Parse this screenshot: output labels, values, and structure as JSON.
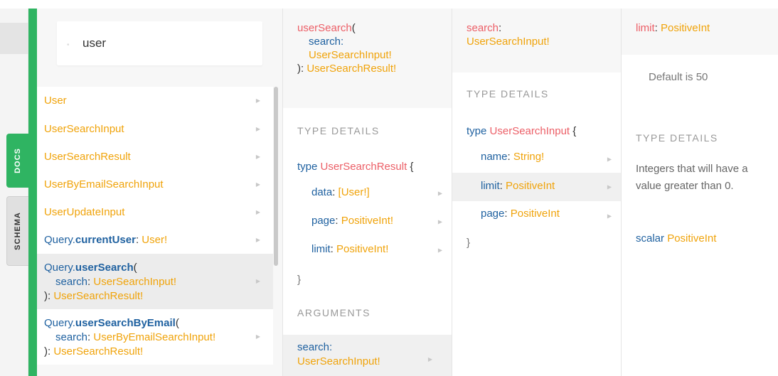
{
  "tabs": {
    "docs": "DOCS",
    "schema": "SCHEMA"
  },
  "search": {
    "value": "user"
  },
  "results": [
    {
      "name": "User"
    },
    {
      "name": "UserSearchInput"
    },
    {
      "name": "UserSearchResult"
    },
    {
      "name": "UserByEmailSearchInput"
    },
    {
      "name": "UserUpdateInput"
    },
    {
      "prefix": "Query.",
      "field": "currentUser",
      "colon": ": ",
      "type": "User!"
    },
    {
      "prefix": "Query.",
      "field": "userSearch",
      "open": "(",
      "arg": "search",
      "argColon": ": ",
      "argType": "UserSearchInput!",
      "close": "): ",
      "type": "UserSearchResult!"
    },
    {
      "prefix": "Query.",
      "field": "userSearchByEmail",
      "open": "(",
      "arg": "search",
      "argColon": ": ",
      "argType": "UserByEmailSearchInput!",
      "close": "): ",
      "type": "UserSearchResult!"
    }
  ],
  "col2": {
    "header": {
      "name": "userSearch",
      "open": "(",
      "arg": "search:",
      "argType": "UserSearchInput!",
      "close": "): ",
      "type": "UserSearchResult!"
    },
    "typeDetails": "TYPE DETAILS",
    "typeKeyword": "type ",
    "typeName": "UserSearchResult",
    "brace": " {",
    "fields": [
      {
        "name": "data",
        "colon": ": ",
        "type": "[User!]"
      },
      {
        "name": "page",
        "colon": ": ",
        "type": "PositiveInt!"
      },
      {
        "name": "limit",
        "colon": ": ",
        "type": "PositiveInt!"
      }
    ],
    "closeBrace": "}",
    "arguments": "ARGUMENTS",
    "argument": {
      "name": "search:",
      "type": "UserSearchInput!"
    }
  },
  "col3": {
    "header": {
      "name": "search",
      "colon": ":",
      "type": "UserSearchInput!"
    },
    "typeDetails": "TYPE DETAILS",
    "typeKeyword": "type ",
    "typeName": "UserSearchInput",
    "brace": " {",
    "fields": [
      {
        "name": "name",
        "colon": ": ",
        "type": "String!"
      },
      {
        "name": "limit",
        "colon": ": ",
        "type": "PositiveInt"
      },
      {
        "name": "page",
        "colon": ": ",
        "type": "PositiveInt"
      }
    ],
    "closeBrace": "}"
  },
  "col4": {
    "header": {
      "name": "limit",
      "colon": ": ",
      "type": "PositiveInt"
    },
    "default": "Default is 50",
    "typeDetails": "TYPE DETAILS",
    "description": "Integers that will have a value greater than 0.",
    "scalarKeyword": "scalar ",
    "scalarName": "PositiveInt"
  }
}
